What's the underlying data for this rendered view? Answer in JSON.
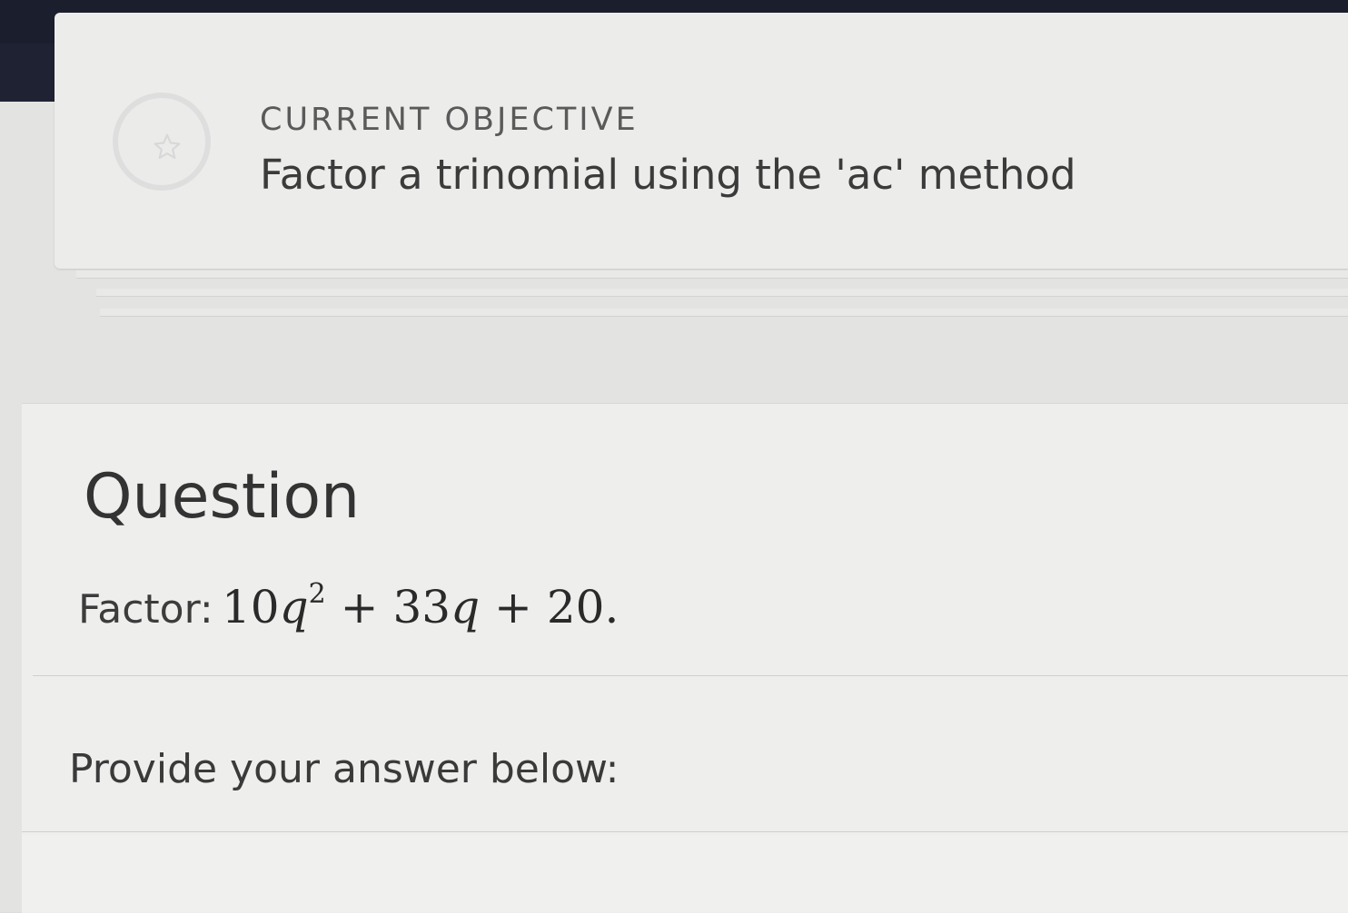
{
  "objective": {
    "label": "CURRENT OBJECTIVE",
    "title": "Factor a trinomial using the 'ac' method",
    "icon": "star-icon"
  },
  "question": {
    "heading": "Question",
    "prompt_label": "Factor:",
    "expression": {
      "coef1": "10",
      "var1": "q",
      "exp1": "2",
      "op1": "+",
      "coef2": "33",
      "var2": "q",
      "op2": "+",
      "const": "20",
      "end": "."
    },
    "answer_prompt": "Provide your answer below:"
  }
}
